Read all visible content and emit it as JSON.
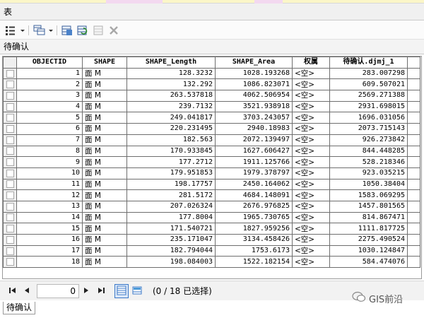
{
  "window": {
    "title": "表"
  },
  "toolbar": {
    "icons": [
      "table-options-icon",
      "related-tables-icon",
      "select-by-attributes-icon",
      "switch-selection-icon",
      "clear-selection-icon",
      "delete-selected-icon"
    ]
  },
  "tab": {
    "label": "待确认"
  },
  "table": {
    "columns": [
      "OBJECTID",
      "SHAPE",
      "SHAPE_Length",
      "SHAPE_Area",
      "权属",
      "待确认.djmj_1"
    ],
    "rows": [
      [
        "1",
        "面 M",
        "128.3232",
        "1028.193268",
        "<空>",
        "283.007298"
      ],
      [
        "2",
        "面 M",
        "132.292",
        "1086.823071",
        "<空>",
        "609.507021"
      ],
      [
        "3",
        "面 M",
        "263.537818",
        "4062.506954",
        "<空>",
        "2569.271388"
      ],
      [
        "4",
        "面 M",
        "239.7132",
        "3521.938918",
        "<空>",
        "2931.698015"
      ],
      [
        "5",
        "面 M",
        "249.041817",
        "3703.243057",
        "<空>",
        "1696.031056"
      ],
      [
        "6",
        "面 M",
        "220.231495",
        "2940.18983",
        "<空>",
        "2073.715143"
      ],
      [
        "7",
        "面 M",
        "182.563",
        "2072.139497",
        "<空>",
        "926.273842"
      ],
      [
        "8",
        "面 M",
        "170.933845",
        "1627.606427",
        "<空>",
        "844.448285"
      ],
      [
        "9",
        "面 M",
        "177.2712",
        "1911.125766",
        "<空>",
        "528.218346"
      ],
      [
        "10",
        "面 M",
        "179.951853",
        "1979.378797",
        "<空>",
        "923.035215"
      ],
      [
        "11",
        "面 M",
        "198.17757",
        "2450.164062",
        "<空>",
        "1050.38404"
      ],
      [
        "12",
        "面 M",
        "281.5172",
        "4684.148091",
        "<空>",
        "1583.069295"
      ],
      [
        "13",
        "面 M",
        "207.026324",
        "2676.976825",
        "<空>",
        "1457.801565"
      ],
      [
        "14",
        "面 M",
        "177.8004",
        "1965.730765",
        "<空>",
        "814.867471"
      ],
      [
        "15",
        "面 M",
        "171.540721",
        "1827.959256",
        "<空>",
        "1111.817725"
      ],
      [
        "16",
        "面 M",
        "235.171047",
        "3134.458426",
        "<空>",
        "2275.490524"
      ],
      [
        "17",
        "面 M",
        "182.794044",
        "1753.6173",
        "<空>",
        "1030.124847"
      ],
      [
        "18",
        "面 M",
        "198.084003",
        "1522.182154",
        "<空>",
        "584.474076"
      ]
    ]
  },
  "navigator": {
    "current_record": "0",
    "status": "(0 / 18 已选择)"
  },
  "bottom_tab": {
    "label": "待确认"
  },
  "watermark": {
    "text": "GIS前沿"
  },
  "colors": {
    "accent": "#3b78c8",
    "grid_line": "#6e6e6e",
    "toolbar_bg": "#fbfbfb"
  }
}
